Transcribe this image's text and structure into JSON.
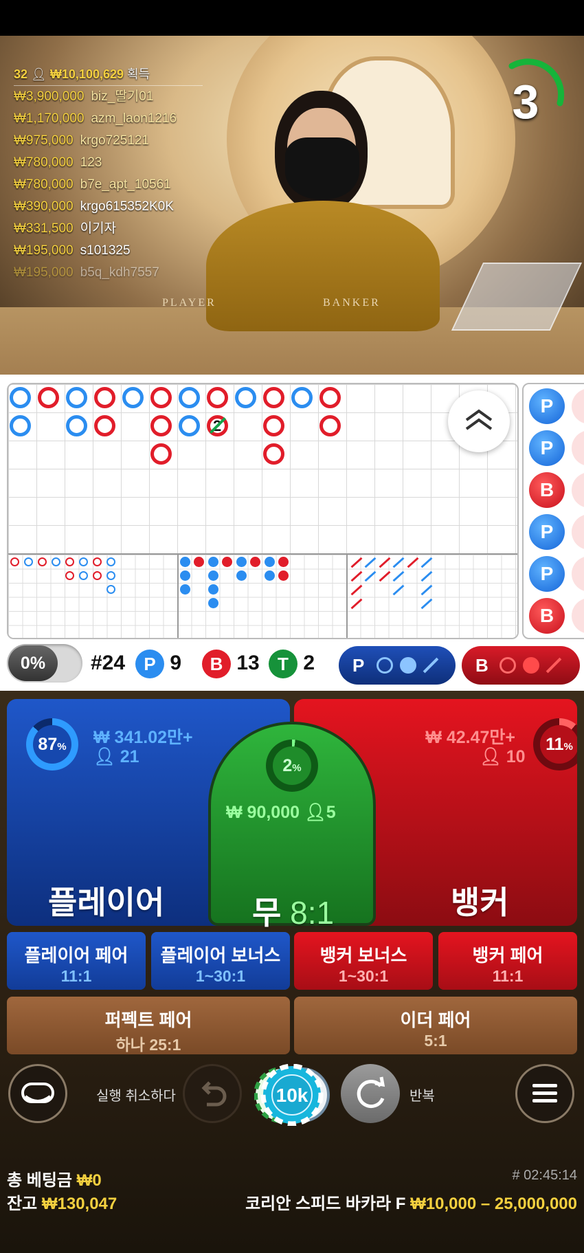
{
  "video": {
    "winners_header": {
      "count": "32",
      "total": "₩10,100,629",
      "label": "획득"
    },
    "winners": [
      {
        "amount": "₩3,900,000",
        "name": "biz_딸기01"
      },
      {
        "amount": "₩1,170,000",
        "name": "azm_laon1216"
      },
      {
        "amount": "₩975,000",
        "name": "krgo725121"
      },
      {
        "amount": "₩780,000",
        "name": "123"
      },
      {
        "amount": "₩780,000",
        "name": "b7e_apt_10561"
      },
      {
        "amount": "₩390,000",
        "name": "krgo615352K0K"
      },
      {
        "amount": "₩331,500",
        "name": "이기자"
      },
      {
        "amount": "₩195,000",
        "name": "s101325"
      },
      {
        "amount": "₩195,000",
        "name": "b5q_kdh7557"
      }
    ],
    "table_player": "PLAYER",
    "table_banker": "BANKER",
    "countdown": "3"
  },
  "roadmap": {
    "bead_plate": [
      "P",
      "P",
      "B",
      "P",
      "P",
      "B"
    ],
    "tie_mark": "2"
  },
  "stats": {
    "percent": "0%",
    "round": "#24",
    "p_letter": "P",
    "p_count": "9",
    "b_letter": "B",
    "b_count": "13",
    "t_letter": "T",
    "t_count": "2",
    "predict_p": "P",
    "predict_b": "B"
  },
  "bets": {
    "player": {
      "pct": "87",
      "amount": "₩ 341.02만+",
      "users": "21",
      "label": "플레이어"
    },
    "banker": {
      "pct": "11",
      "amount": "₩ 42.47만+",
      "users": "10",
      "label": "뱅커"
    },
    "tie": {
      "pct": "2",
      "amount": "₩ 90,000",
      "users": "5",
      "label": "무",
      "odds": "8:1"
    },
    "side": [
      {
        "label": "플레이어 페어",
        "odds": "11:1"
      },
      {
        "label": "플레이어 보너스",
        "odds": "1~30:1"
      },
      {
        "label": "뱅커 보너스",
        "odds": "1~30:1"
      },
      {
        "label": "뱅커 페어",
        "odds": "11:1"
      }
    ],
    "perfect": {
      "label": "퍼펙트 페어",
      "odds": "하나 25:1"
    },
    "either": {
      "label": "이더 페어",
      "odds": "5:1"
    }
  },
  "controls": {
    "undo_label": "실행 취소하다",
    "chip_value": "10k",
    "repeat_label": "반복"
  },
  "footer": {
    "total_bet_label": "총 베팅금",
    "total_bet_value": "₩0",
    "balance_label": "잔고",
    "balance_value": "₩130,047",
    "game_id": "# 02:45:14",
    "table_name": "코리안 스피드 바카라 F",
    "limits": "₩10,000 – 25,000,000"
  },
  "colors": {
    "player": "#1f57c9",
    "banker": "#e4141f",
    "tie": "#2fb53c",
    "gold": "#f4d03f"
  }
}
